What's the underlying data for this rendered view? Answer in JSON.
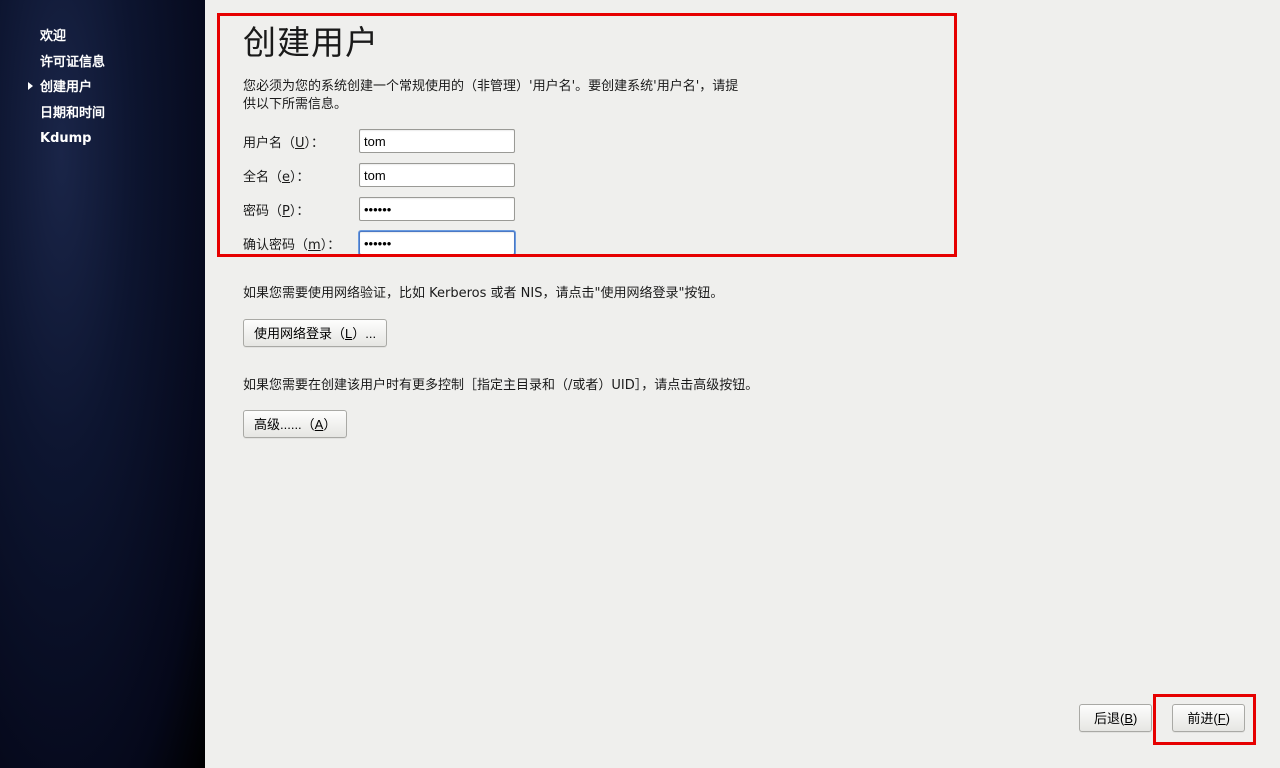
{
  "sidebar": {
    "items": [
      {
        "label": "欢迎",
        "active": false
      },
      {
        "label": "许可证信息",
        "active": false
      },
      {
        "label": "创建用户",
        "active": true
      },
      {
        "label": "日期和时间",
        "active": false
      },
      {
        "label": "Kdump",
        "active": false
      }
    ]
  },
  "page": {
    "title": "创建用户",
    "intro": "您必须为您的系统创建一个常规使用的（非管理）'用户名'。要创建系统'用户名'，请提供以下所需信息。"
  },
  "form": {
    "username": {
      "label_pre": "用户名（",
      "mn": "U",
      "label_post": "）：",
      "value": "tom"
    },
    "fullname": {
      "label_pre": "全名（",
      "mn": "e",
      "label_post": "）：",
      "value": "tom"
    },
    "password": {
      "label_pre": "密码（",
      "mn": "P",
      "label_post": "）：",
      "value": "••••••"
    },
    "confirm": {
      "label_pre": "确认密码（",
      "mn": "m",
      "label_post": "）：",
      "value": "••••••"
    }
  },
  "network_text": "如果您需要使用网络验证，比如 Kerberos 或者 NIS，请点击\"使用网络登录\"按钮。",
  "network_btn": {
    "pre": "使用网络登录（",
    "mn": "L",
    "post": "）..."
  },
  "advanced_text": "如果您需要在创建该用户时有更多控制［指定主目录和（/或者）UID］，请点击高级按钮。",
  "advanced_btn": {
    "pre": "高级......（",
    "mn": "A",
    "post": "）"
  },
  "footer": {
    "back": {
      "pre": "后退(",
      "mn": "B",
      "post": ")"
    },
    "forward": {
      "pre": "前进(",
      "mn": "F",
      "post": ")"
    }
  }
}
